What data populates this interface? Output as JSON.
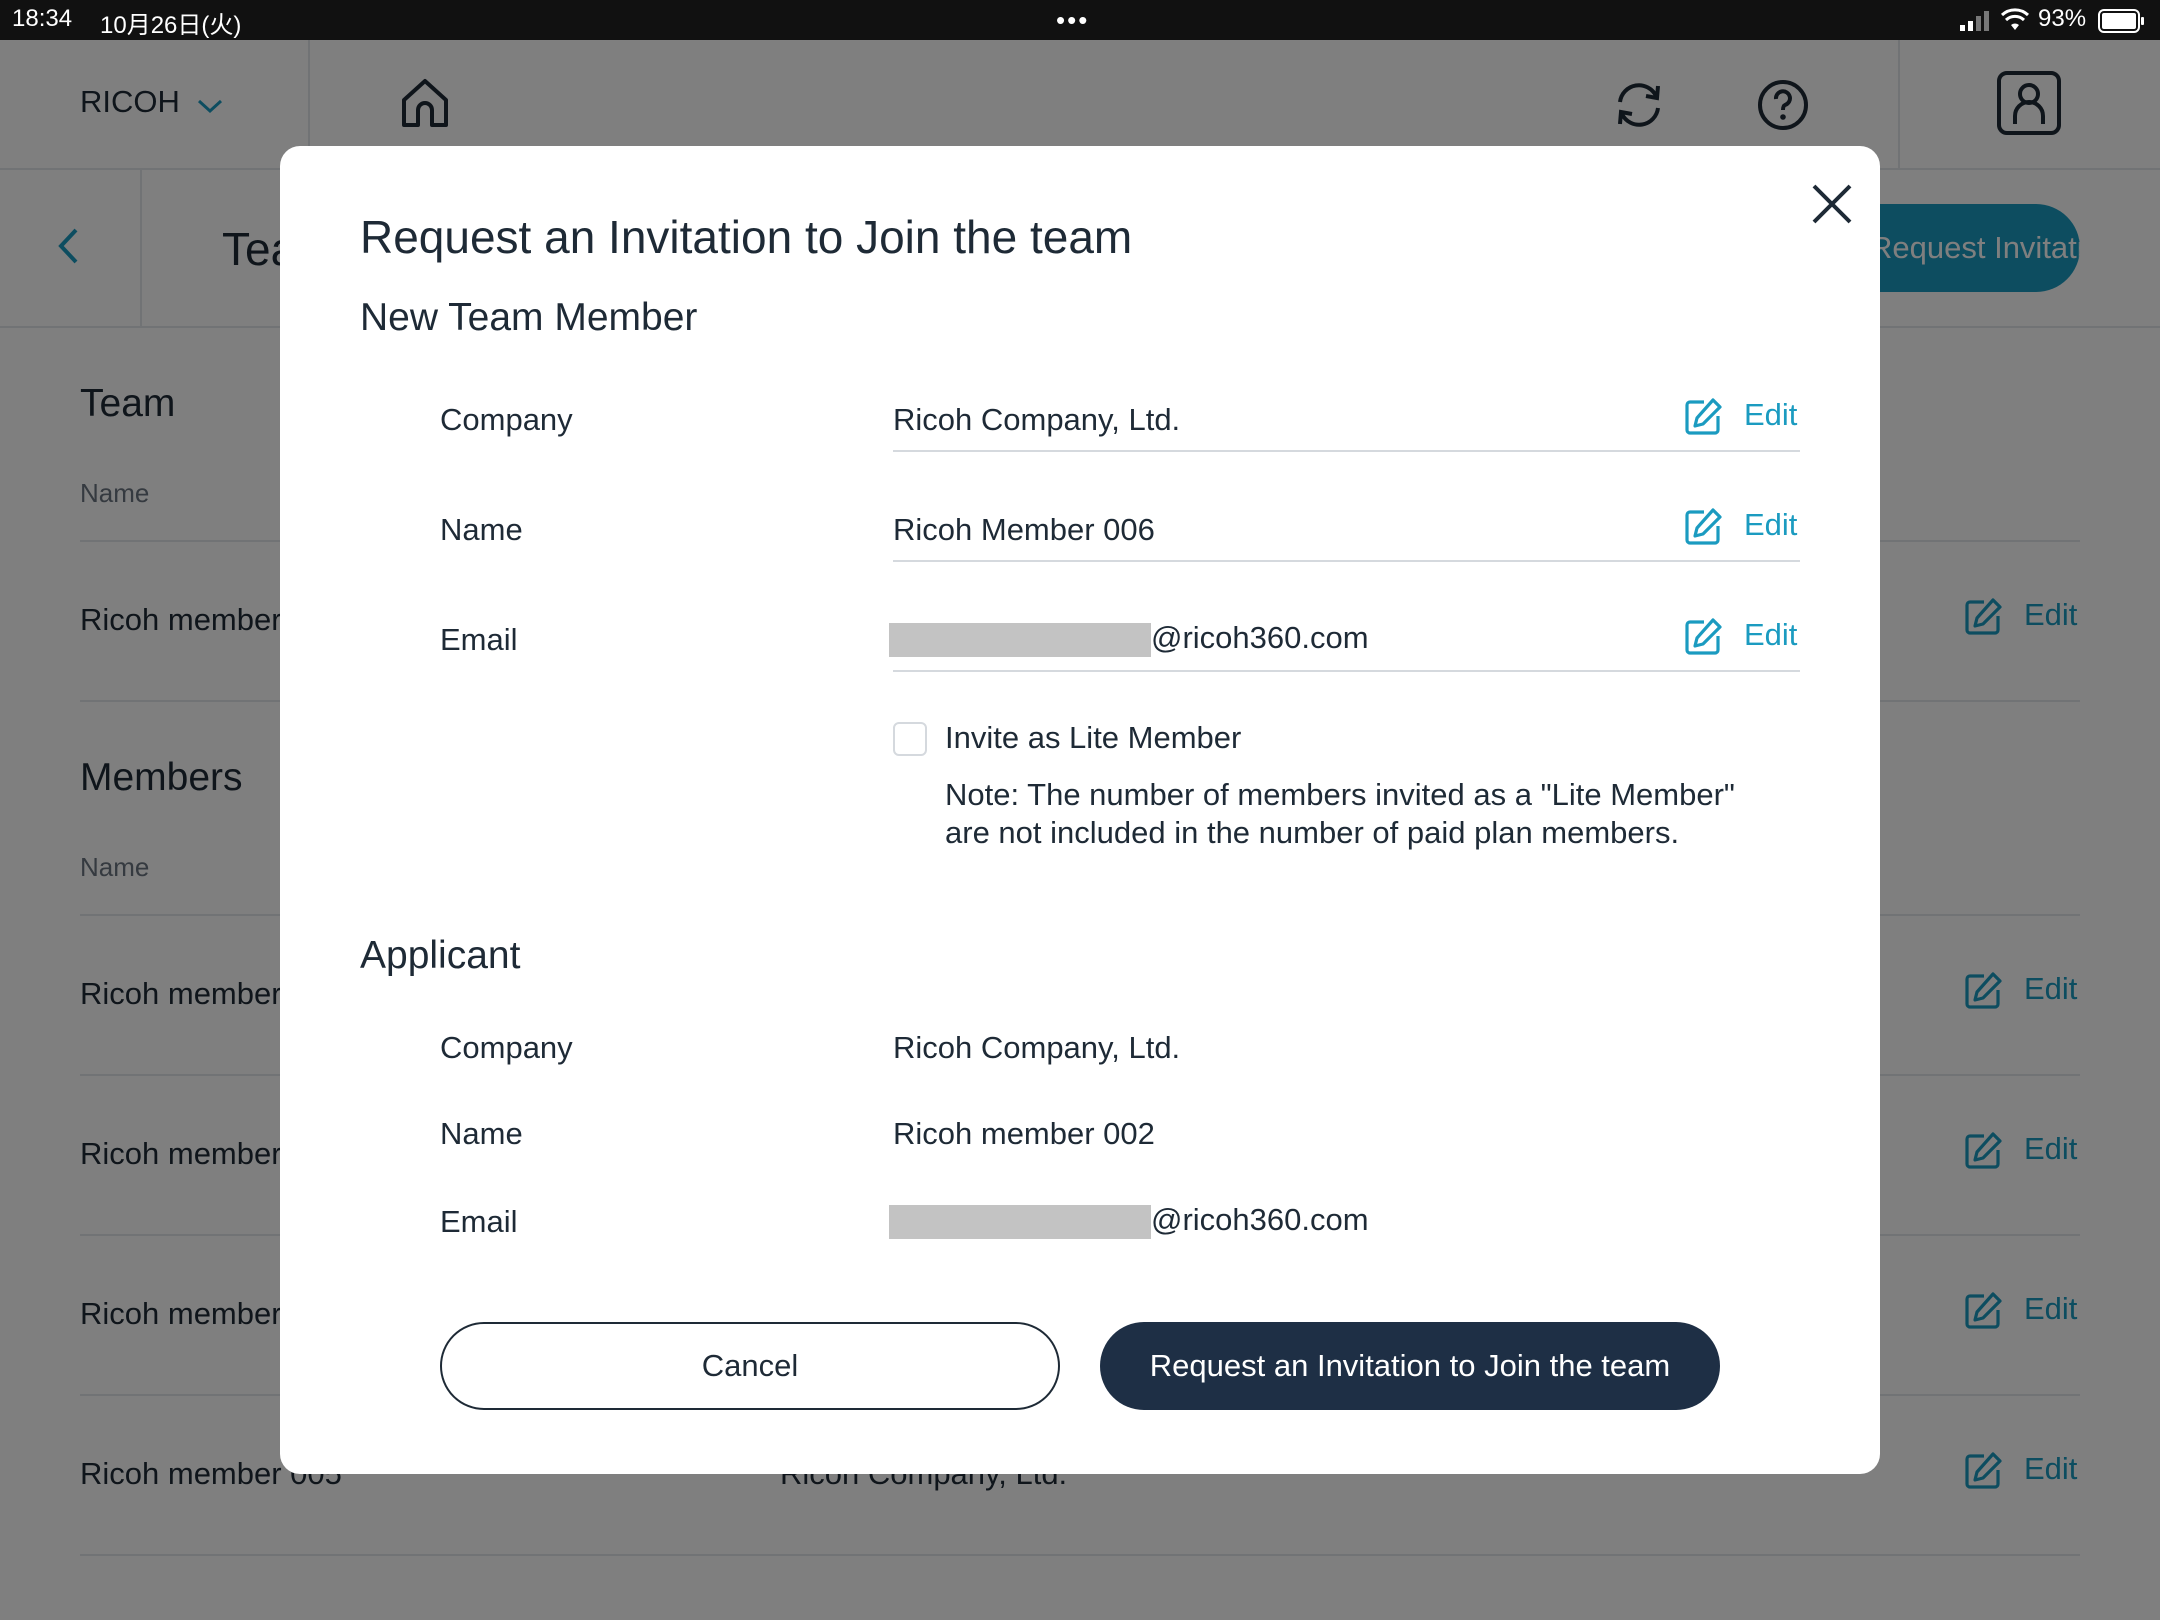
{
  "status_bar": {
    "time": "18:34",
    "date": "10月26日(火)",
    "battery": "93%"
  },
  "app": {
    "org_selector": "RICOH",
    "page_title": "Team",
    "request_button": "Request Invitation",
    "team_section": {
      "title": "Team",
      "name_header": "Name",
      "rows": [
        {
          "name": "Ricoh member",
          "edit": "Edit"
        }
      ]
    },
    "members_section": {
      "title": "Members",
      "name_header": "Name",
      "rows": [
        {
          "name": "Ricoh member",
          "company": "",
          "edit": "Edit"
        },
        {
          "name": "Ricoh member",
          "company": "",
          "edit": "Edit"
        },
        {
          "name": "Ricoh member",
          "company": "",
          "edit": "Edit"
        },
        {
          "name": "Ricoh member 005",
          "company": "Ricoh Company, Ltd.",
          "edit": "Edit"
        }
      ]
    }
  },
  "modal": {
    "title": "Request an Invitation to Join the team",
    "new_member": {
      "heading": "New Team Member",
      "company_label": "Company",
      "company_value": "Ricoh Company, Ltd.",
      "name_label": "Name",
      "name_value": "Ricoh Member 006",
      "email_label": "Email",
      "email_domain": "@ricoh360.com",
      "edit_label": "Edit",
      "lite_member_label": "Invite as Lite Member",
      "lite_member_checked": false,
      "note": "Note: The number of members invited as a \"Lite Member\" are not included in the number of paid plan members."
    },
    "applicant": {
      "heading": "Applicant",
      "company_label": "Company",
      "company_value": "Ricoh Company, Ltd.",
      "name_label": "Name",
      "name_value": "Ricoh member 002",
      "email_label": "Email",
      "email_domain": "@ricoh360.com"
    },
    "cancel_button": "Cancel",
    "submit_button": "Request an Invitation to Join the team"
  },
  "colors": {
    "accent": "#1b9bc0",
    "primary_dark": "#1e2f45",
    "text": "#1e2a36",
    "overlay": "rgba(0,0,0,0.5)"
  }
}
